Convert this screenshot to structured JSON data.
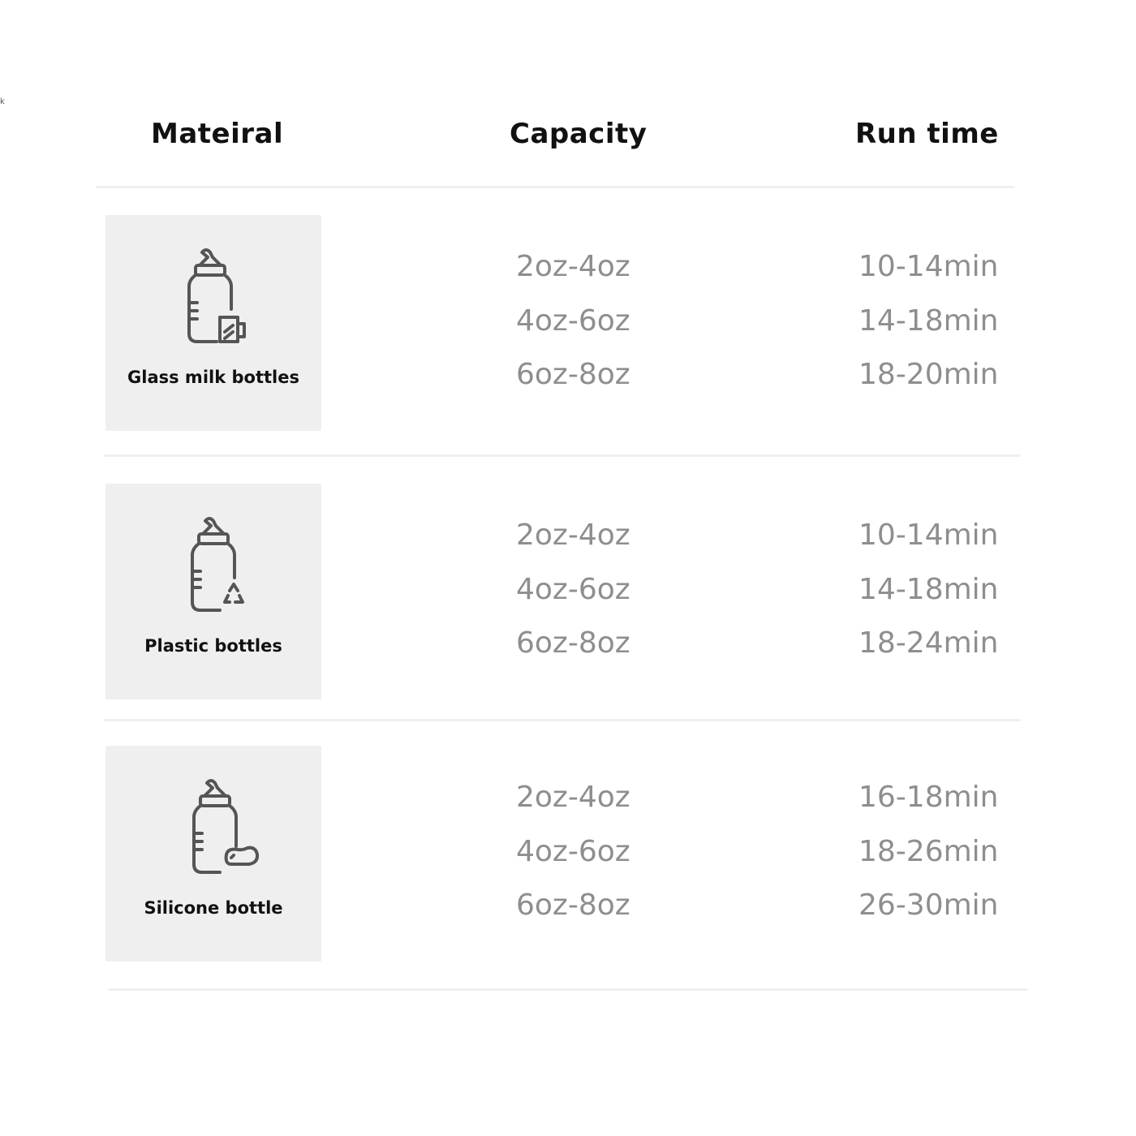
{
  "stray_mark": "k",
  "headers": {
    "material": "Mateiral",
    "capacity": "Capacity",
    "run_time": "Run time"
  },
  "rows": [
    {
      "material": "Glass milk bottles",
      "icon": "glass-bottle-icon",
      "capacities": [
        "2oz-4oz",
        "4oz-6oz",
        "6oz-8oz"
      ],
      "run_times": [
        "10-14min",
        "14-18min",
        "18-20min"
      ]
    },
    {
      "material": "Plastic bottles",
      "icon": "plastic-bottle-icon",
      "capacities": [
        "2oz-4oz",
        "4oz-6oz",
        "6oz-8oz"
      ],
      "run_times": [
        "10-14min",
        "14-18min",
        "18-24min"
      ]
    },
    {
      "material": "Silicone bottle",
      "icon": "silicone-bottle-icon",
      "capacities": [
        "2oz-4oz",
        "4oz-6oz",
        "6oz-8oz"
      ],
      "run_times": [
        "16-18min",
        "18-26min",
        "26-30min"
      ]
    }
  ]
}
